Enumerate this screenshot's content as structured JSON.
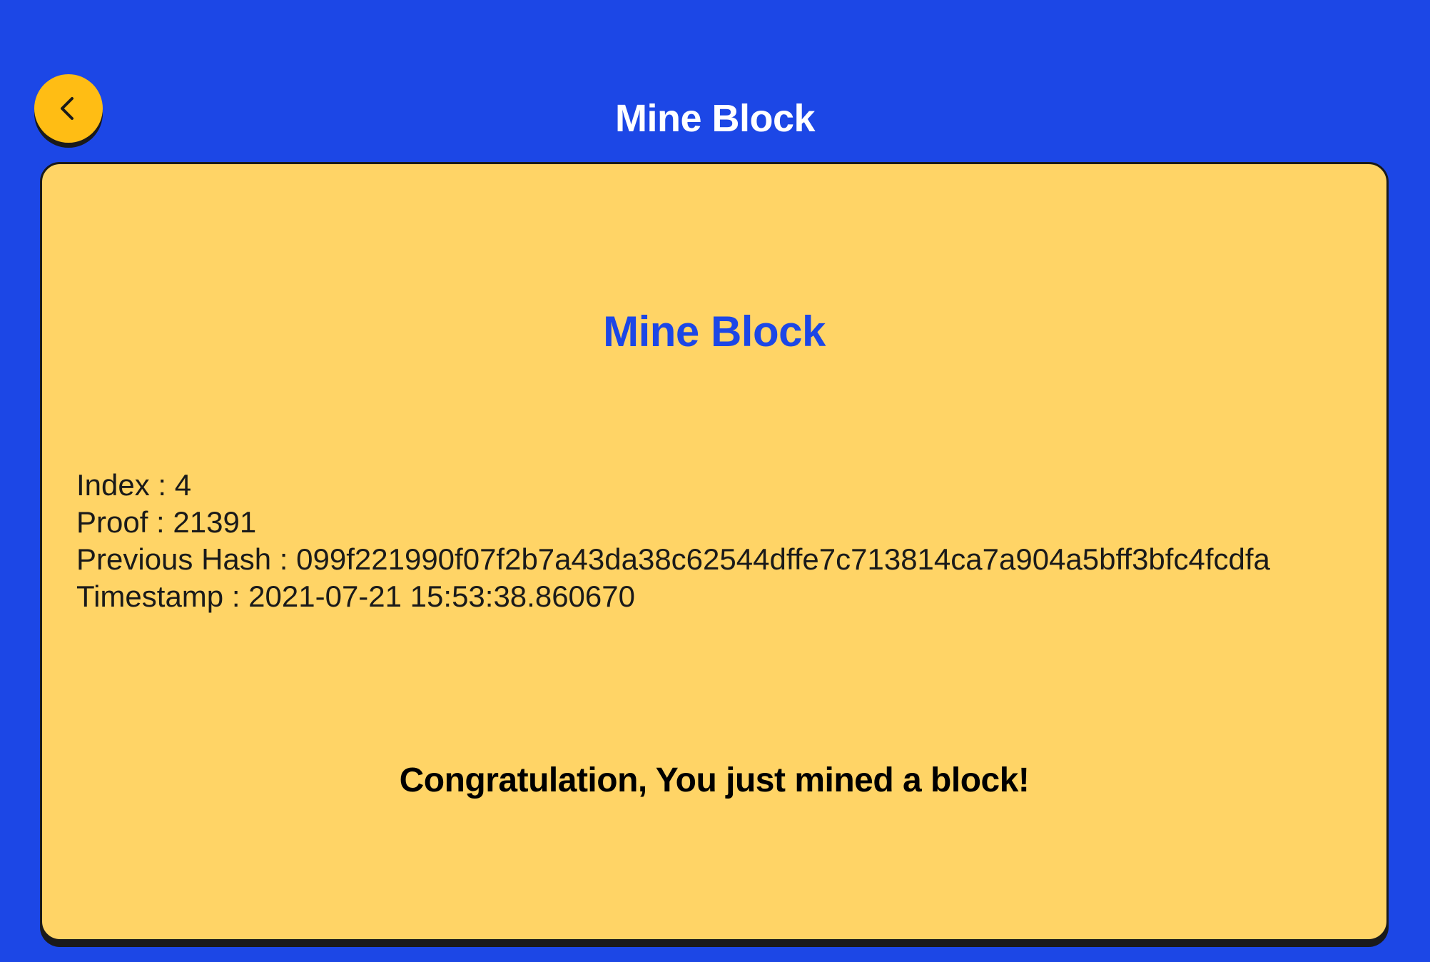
{
  "header": {
    "back_icon": "chevron-left-icon",
    "title": "Mine Block"
  },
  "card": {
    "title": "Mine Block",
    "details": [
      {
        "label": "Index",
        "separator": " : ",
        "value": "4"
      },
      {
        "label": "Proof",
        "separator": " : ",
        "value": "21391"
      },
      {
        "label": "Previous Hash",
        "separator": " : ",
        "value": "099f221990f07f2b7a43da38c62544dffe7c713814ca7a904a5bff3bfc4fcdfa"
      },
      {
        "label": "Timestamp",
        "separator": " : ",
        "value": "2021-07-21 15:53:38.860670"
      }
    ],
    "message": "Congratulation, You just mined a block!"
  },
  "colors": {
    "background": "#1c47e6",
    "card": "#ffd466",
    "accent_button": "#ffbd14",
    "title_blue": "#1c47e6"
  }
}
